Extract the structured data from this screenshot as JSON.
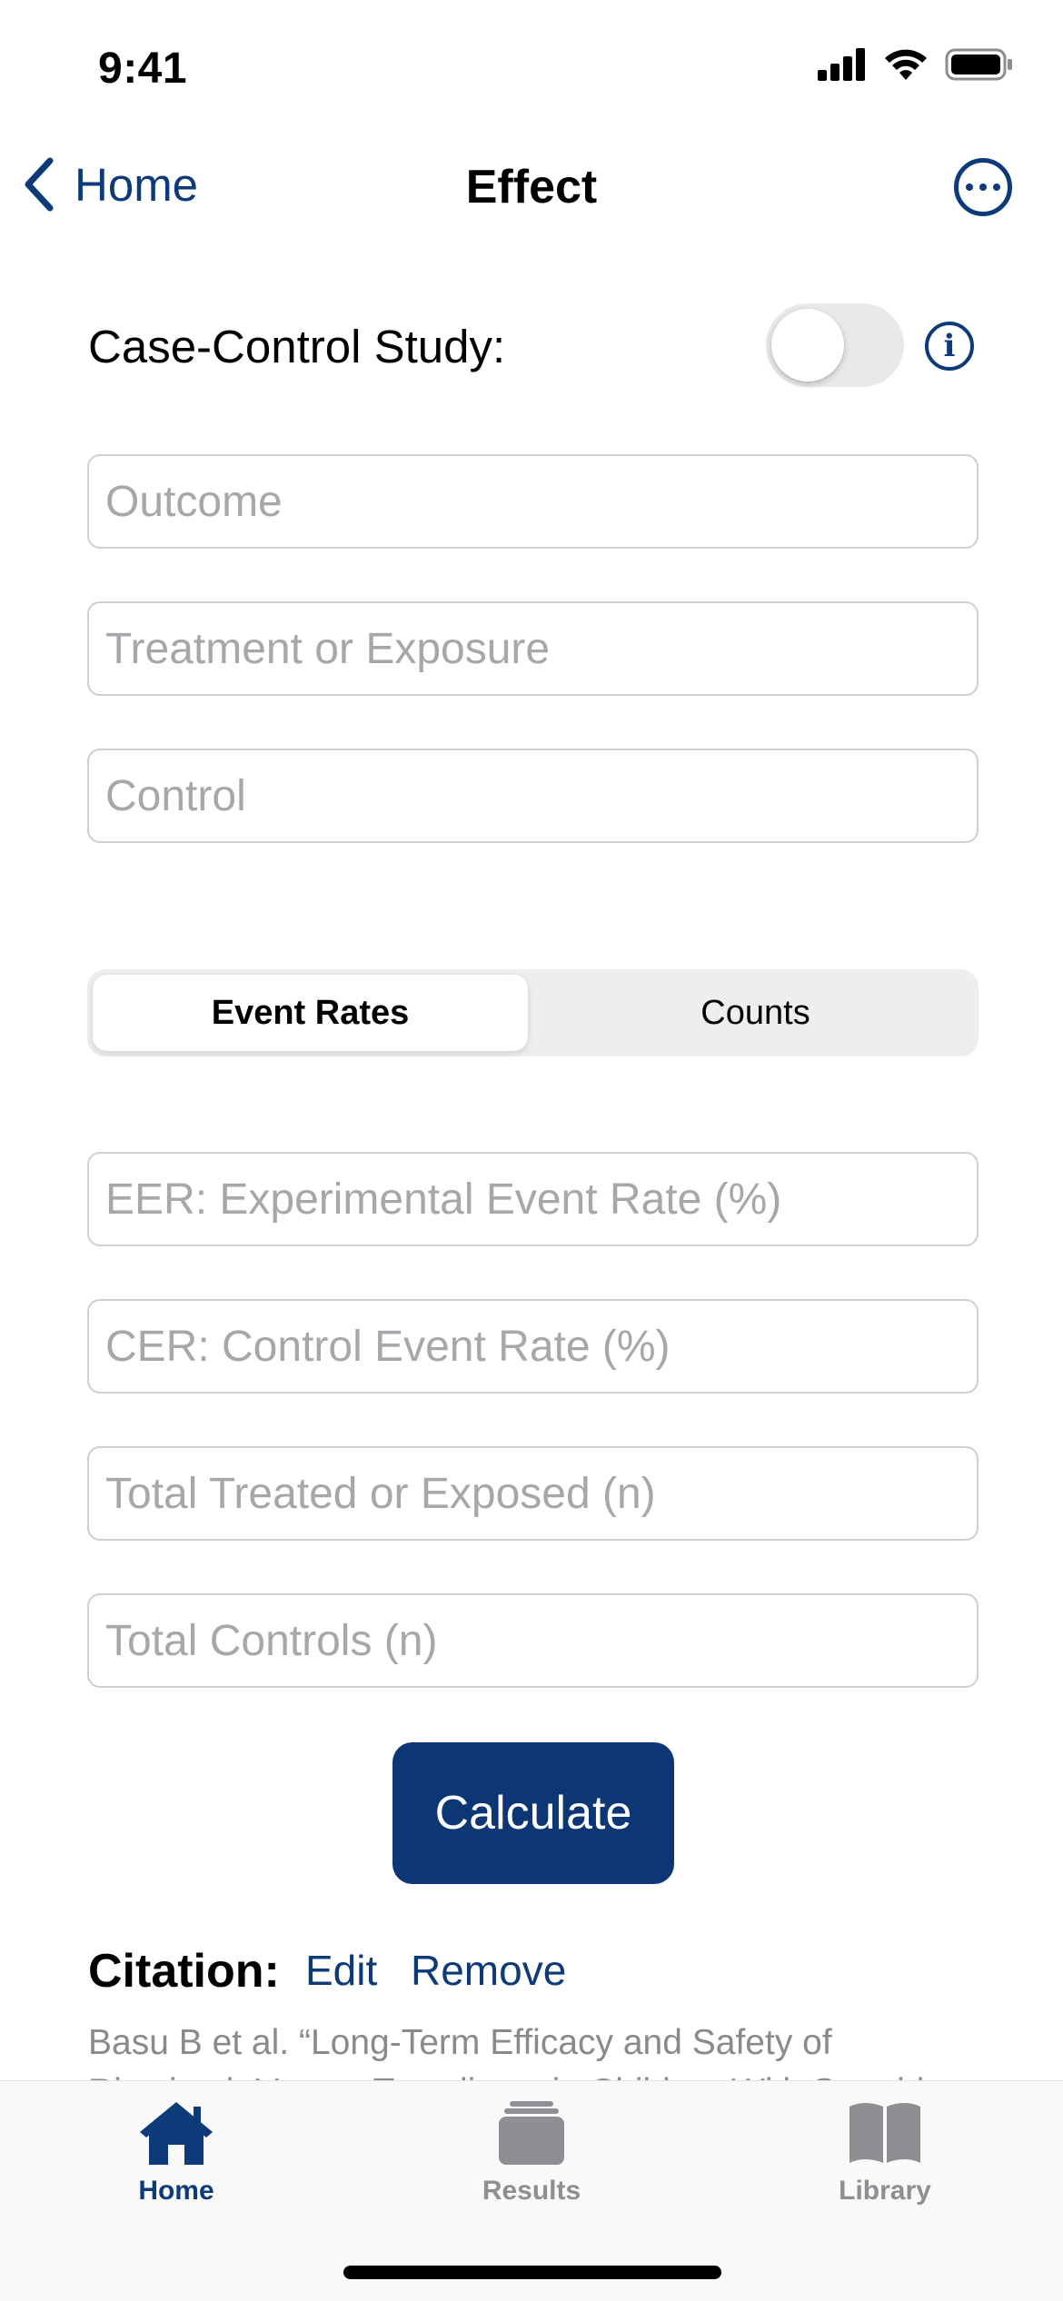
{
  "status_bar": {
    "time": "9:41"
  },
  "nav": {
    "back_label": "Home",
    "title": "Effect"
  },
  "case_control": {
    "label": "Case-Control Study:",
    "enabled": false
  },
  "fields_top": {
    "outcome": {
      "placeholder": "Outcome",
      "value": ""
    },
    "treatment": {
      "placeholder": "Treatment or Exposure",
      "value": ""
    },
    "control": {
      "placeholder": "Control",
      "value": ""
    }
  },
  "segmented": {
    "options": [
      "Event Rates",
      "Counts"
    ],
    "selected": "Event Rates"
  },
  "fields_rates": {
    "eer": {
      "placeholder": "EER: Experimental Event Rate (%)",
      "value": ""
    },
    "cer": {
      "placeholder": "CER: Control Event Rate (%)",
      "value": ""
    },
    "total_treated": {
      "placeholder": "Total Treated or Exposed (n)",
      "value": ""
    },
    "total_controls": {
      "placeholder": "Total Controls (n)",
      "value": ""
    }
  },
  "calculate_label": "Calculate",
  "citation": {
    "label": "Citation:",
    "edit_label": "Edit",
    "remove_label": "Remove",
    "text": "Basu B et al. “Long-Term Efficacy and Safety of Rituximab Versus Tacrolimus in Children With Steroid"
  },
  "tabbar": {
    "items": [
      {
        "label": "Home",
        "icon": "house-icon",
        "active": true
      },
      {
        "label": "Results",
        "icon": "stack-icon",
        "active": false
      },
      {
        "label": "Library",
        "icon": "book-icon",
        "active": false
      }
    ]
  },
  "colors": {
    "accent": "#0d3a78",
    "button": "#0c3674",
    "inactive": "#8e8e93",
    "placeholder": "#a7a7ab"
  }
}
